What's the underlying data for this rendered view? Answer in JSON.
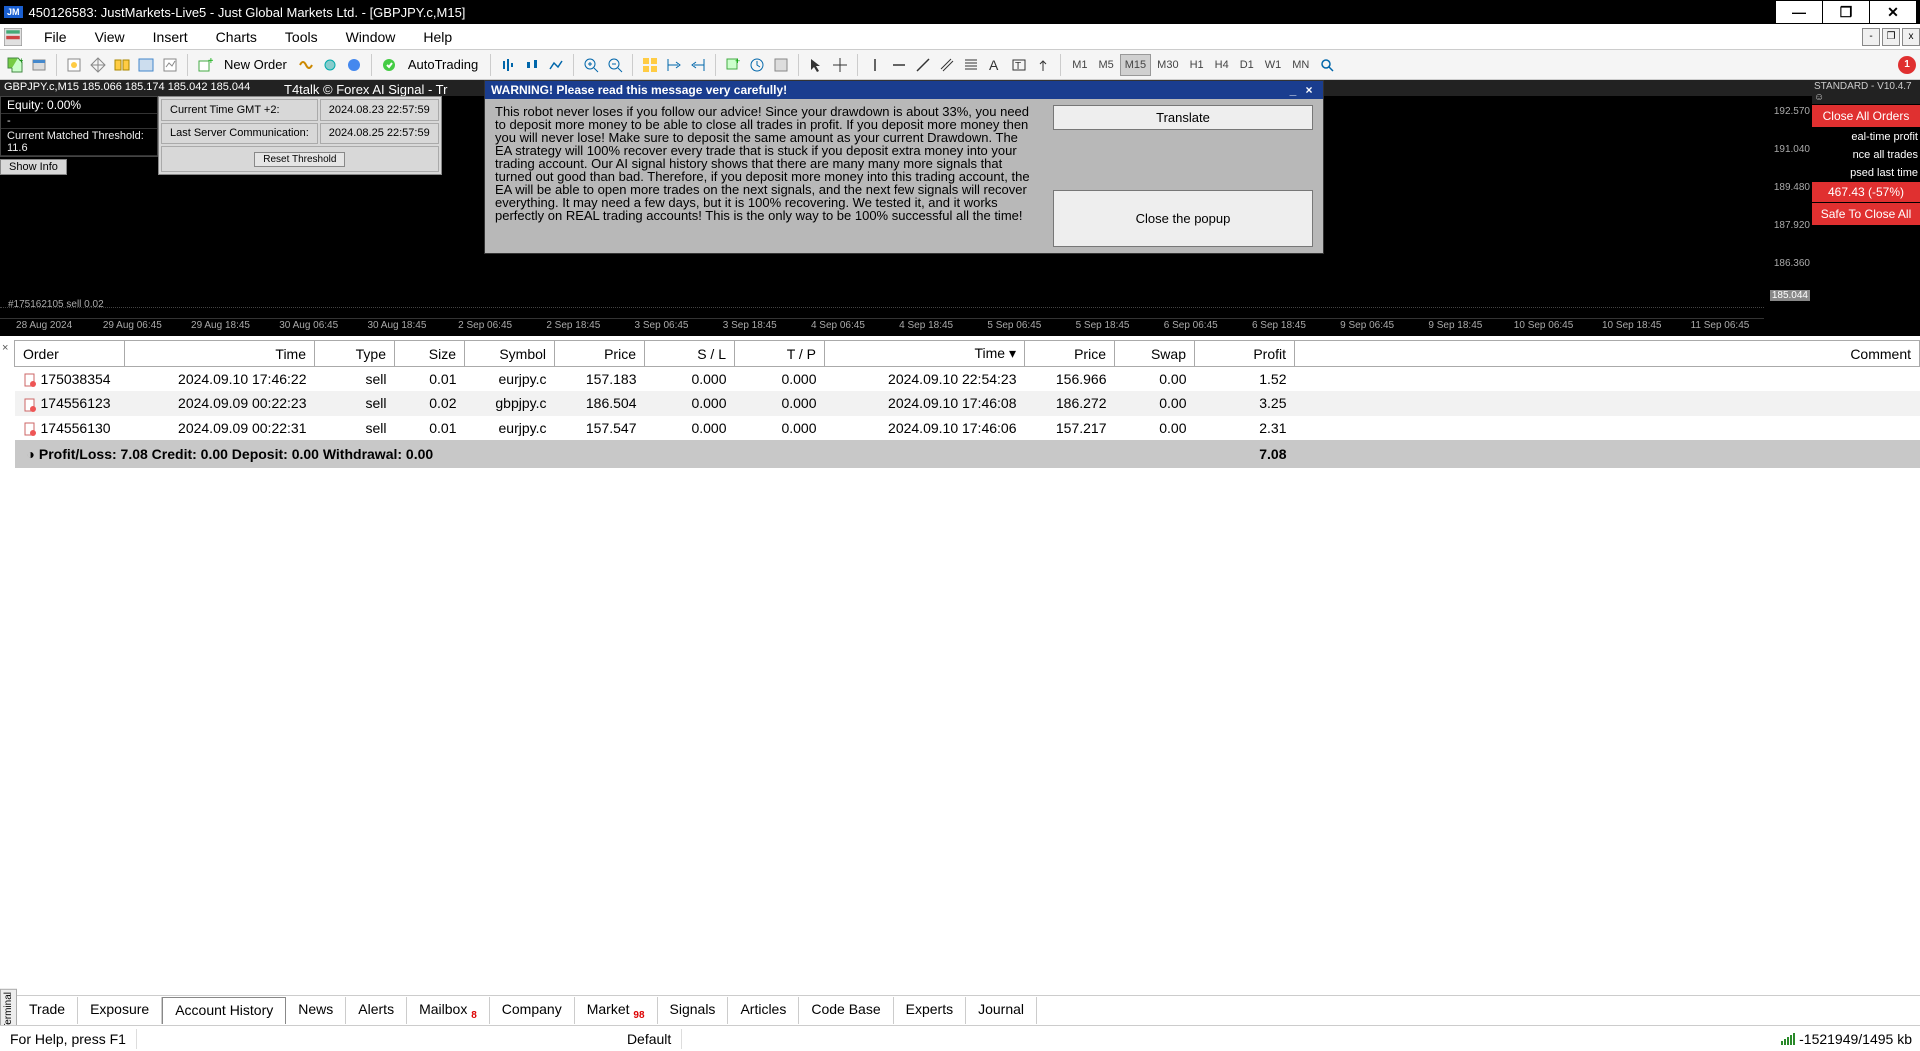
{
  "window": {
    "account_tag": "JM",
    "title": "450126583: JustMarkets-Live5 - Just Global Markets Ltd. - [GBPJPY.c,M15]",
    "min": "—",
    "max": "❐",
    "close": "✕"
  },
  "menu": [
    "File",
    "View",
    "Insert",
    "Charts",
    "Tools",
    "Window",
    "Help"
  ],
  "mdi": [
    "-",
    "❐",
    "x"
  ],
  "toolbar": {
    "new_order": "New Order",
    "autotrading": "AutoTrading",
    "timeframes": [
      "M1",
      "M5",
      "M15",
      "M30",
      "H1",
      "H4",
      "D1",
      "W1",
      "MN"
    ],
    "active_tf": "M15",
    "notif_count": "1"
  },
  "chart": {
    "header_ohlc": "GBPJPY.c,M15  185.066 185.174 185.042 185.044",
    "header_signal": "T4talk © Forex AI Signal - Tr",
    "equity_label": "Equity: 0.00%",
    "dash": "-",
    "threshold_label": "Current Matched Threshold: 11.6",
    "show_info": "Show Info",
    "mid": {
      "cur_time_label": "Current Time GMT +2:",
      "cur_time_val": "2024.08.23 22:57:59",
      "last_comm_label": "Last Server Communication:",
      "last_comm_val": "2024.08.25 22:57:59",
      "reset": "Reset Threshold"
    },
    "right": {
      "header": "STANDARD - V10.4.7 ☺",
      "close_all": "Close All Orders",
      "line1": "eal-time profit",
      "line2": "nce all trades",
      "line3": "psed last time",
      "pct": "467.43 (-57%)",
      "safe": "Safe To Close All"
    },
    "prices": [
      "192.570",
      "191.040",
      "189.480",
      "187.920",
      "186.360",
      "185.044"
    ],
    "sell_label": "#175162105 sell 0.02",
    "times": [
      "28 Aug 2024",
      "29 Aug 06:45",
      "29 Aug 18:45",
      "30 Aug 06:45",
      "30 Aug 18:45",
      "2 Sep 06:45",
      "2 Sep 18:45",
      "3 Sep 06:45",
      "3 Sep 18:45",
      "4 Sep 06:45",
      "4 Sep 18:45",
      "5 Sep 06:45",
      "5 Sep 18:45",
      "6 Sep 06:45",
      "6 Sep 18:45",
      "9 Sep 06:45",
      "9 Sep 18:45",
      "10 Sep 06:45",
      "10 Sep 18:45",
      "11 Sep 06:45"
    ]
  },
  "popup": {
    "title": "WARNING! Please read this message very carefully!",
    "translate": "Translate",
    "close": "Close the popup",
    "body": "This robot never loses if you follow our advice! Since your drawdown is about 33%, you need to deposit more money to be able to close all trades in profit. If you deposit more money then you will never lose! Make sure to deposit the same amount as your current Drawdown. The EA strategy will 100% recover every trade that is stuck if you deposit extra money into your trading account. Our AI signal history shows that there are many many more signals that turned out good than bad. Therefore, if you deposit more money into this trading account, the EA will be able to open more trades on the next signals, and the next few signals will recover everything. It may need a few days, but it is 100% recovering. We tested it, and it works perfectly on REAL trading accounts! This is the only way to be 100% successful all the time!"
  },
  "table": {
    "headers": [
      "Order",
      "Time",
      "Type",
      "Size",
      "Symbol",
      "Price",
      "S / L",
      "T / P",
      "Time ▾",
      "Price",
      "Swap",
      "Profit",
      "Comment"
    ],
    "rows": [
      {
        "order": "175038354",
        "time": "2024.09.10 17:46:22",
        "type": "sell",
        "size": "0.01",
        "symbol": "eurjpy.c",
        "price": "157.183",
        "sl": "0.000",
        "tp": "0.000",
        "time2": "2024.09.10 22:54:23",
        "price2": "156.966",
        "swap": "0.00",
        "profit": "1.52",
        "comment": ""
      },
      {
        "order": "174556123",
        "time": "2024.09.09 00:22:23",
        "type": "sell",
        "size": "0.02",
        "symbol": "gbpjpy.c",
        "price": "186.504",
        "sl": "0.000",
        "tp": "0.000",
        "time2": "2024.09.10 17:46:08",
        "price2": "186.272",
        "swap": "0.00",
        "profit": "3.25",
        "comment": ""
      },
      {
        "order": "174556130",
        "time": "2024.09.09 00:22:31",
        "type": "sell",
        "size": "0.01",
        "symbol": "eurjpy.c",
        "price": "157.547",
        "sl": "0.000",
        "tp": "0.000",
        "time2": "2024.09.10 17:46:06",
        "price2": "157.217",
        "swap": "0.00",
        "profit": "2.31",
        "comment": ""
      }
    ],
    "summary": "Profit/Loss: 7.08   Credit: 0.00   Deposit: 0.00   Withdrawal: 0.00",
    "summary_profit": "7.08"
  },
  "tabs": {
    "vertical": "Terminal",
    "items": [
      "Trade",
      "Exposure",
      "Account History",
      "News",
      "Alerts",
      "Mailbox",
      "Company",
      "Market",
      "Signals",
      "Articles",
      "Code Base",
      "Experts",
      "Journal"
    ],
    "active": "Account History",
    "mailbox_badge": "8",
    "market_badge": "98"
  },
  "status": {
    "help": "For Help, press F1",
    "default": "Default",
    "conn": "-1521949/1495 kb"
  }
}
